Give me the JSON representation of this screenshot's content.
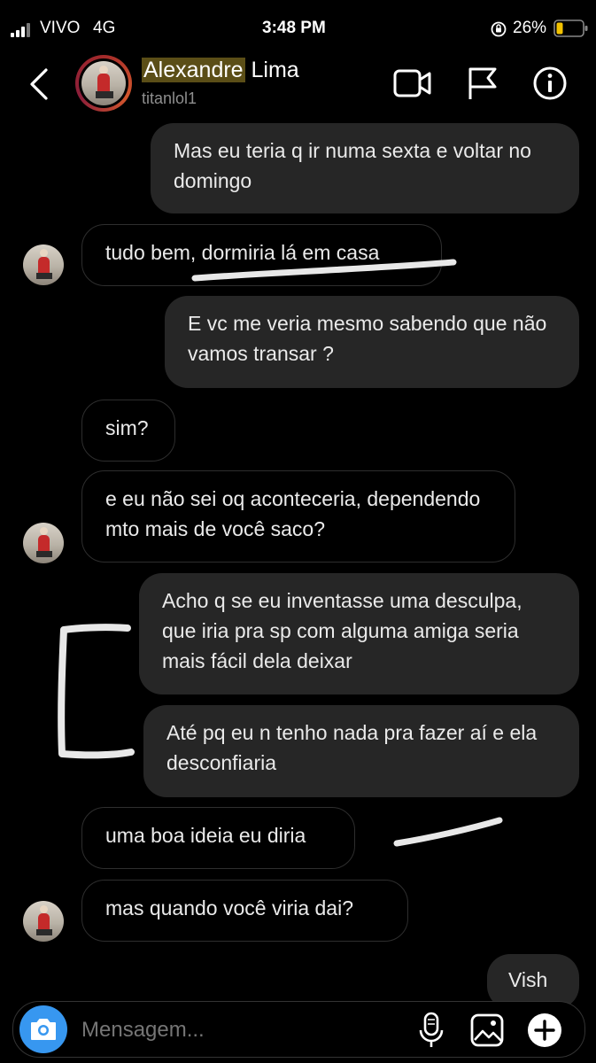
{
  "status_bar": {
    "carrier": "VIVO",
    "network": "4G",
    "time": "3:48 PM",
    "battery": "26%"
  },
  "header": {
    "name_highlight": "Alexandre",
    "name_rest": " Lima",
    "username": "titanlol1",
    "icons": [
      "back-chevron-icon",
      "video-call-icon",
      "flag-icon",
      "info-icon"
    ]
  },
  "messages": [
    {
      "sender": "me",
      "text": "Mas eu teria q ir numa sexta e voltar no domingo"
    },
    {
      "sender": "them",
      "text": "tudo bem, dormiria lá em casa"
    },
    {
      "sender": "me",
      "text": "E vc me veria mesmo sabendo que não vamos transar ?"
    },
    {
      "sender": "them",
      "text": "sim?"
    },
    {
      "sender": "them",
      "text": "e eu não sei oq aconteceria, dependendo mto mais de você saco?"
    },
    {
      "sender": "me",
      "text": "Acho q se eu inventasse uma desculpa, que iria pra sp com alguma amiga seria mais fácil dela deixar"
    },
    {
      "sender": "me",
      "text": "Até pq eu n tenho nada pra fazer aí e ela desconfiaria"
    },
    {
      "sender": "them",
      "text": "uma boa ideia eu diria"
    },
    {
      "sender": "them",
      "text": "mas quando você viria dai?"
    },
    {
      "sender": "me",
      "text": "Vish"
    }
  ],
  "composer": {
    "placeholder": "Mensagem...",
    "icons": [
      "camera-icon",
      "microphone-icon",
      "gallery-icon",
      "add-icon"
    ]
  },
  "colors": {
    "background": "#000000",
    "outgoing_bubble": "#262626",
    "incoming_border": "#2e2e2e",
    "camera_button": "#3797f0",
    "name_highlight": "#5b4e17"
  }
}
